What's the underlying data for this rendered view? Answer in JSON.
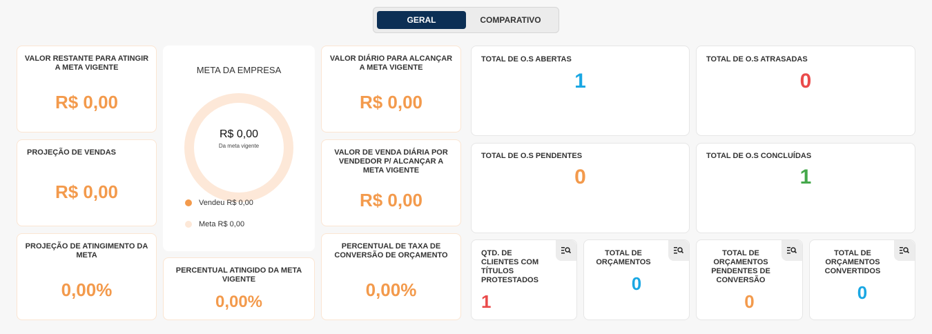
{
  "tabs": [
    {
      "label": "GERAL",
      "active": true
    },
    {
      "label": "COMPARATIVO",
      "active": false
    }
  ],
  "left_cards": {
    "valor_restante": {
      "title": "VALOR RESTANTE PARA ATINGIR A META VIGENTE",
      "value": "R$ 0,00"
    },
    "projecao_vendas": {
      "title": "PROJEÇÃO DE VENDAS",
      "value": "R$ 0,00"
    },
    "projecao_atingimento": {
      "title": "PROJEÇÃO DE ATINGIMENTO DA META",
      "value": "0,00%"
    }
  },
  "meta_empresa": {
    "title": "META DA EMPRESA",
    "center_value": "R$ 0,00",
    "center_caption": "Da meta vigente",
    "progress": 0,
    "legend": [
      {
        "label": "Vendeu",
        "value": "R$ 0,00",
        "color": "#f39a4c"
      },
      {
        "label": "Meta",
        "value": "R$ 0,00",
        "color": "#fde8d8"
      }
    ]
  },
  "percentual_atingido": {
    "title": "PERCENTUAL ATINGIDO DA META VIGENTE",
    "value": "0,00%"
  },
  "middle_cards": {
    "valor_diario": {
      "title": "VALOR DIÁRIO PARA ALCANÇAR A META VIGENTE",
      "value": "R$ 0,00"
    },
    "valor_vendedor": {
      "title": "VALOR DE VENDA DIÁRIA POR VENDEDOR P/ ALCANÇAR A META VIGENTE",
      "value": "R$ 0,00"
    },
    "percentual_conversao": {
      "title": "PERCENTUAL DE TAXA DE CONVERSÃO DE ORÇAMENTO",
      "value": "0,00%"
    }
  },
  "os_cards": {
    "abertas": {
      "title": "TOTAL DE O.S ABERTAS",
      "value": "1"
    },
    "atrasadas": {
      "title": "TOTAL DE O.S ATRASADAS",
      "value": "0"
    },
    "pendentes": {
      "title": "TOTAL DE O.S PENDENTES",
      "value": "0"
    },
    "concluidas": {
      "title": "TOTAL DE O.S CONCLUÍDAS",
      "value": "1"
    }
  },
  "small_cards": {
    "protestados": {
      "title": "QTD. DE CLIENTES COM TÍTULOS PROTESTADOS",
      "value": "1"
    },
    "orcamentos": {
      "title": "TOTAL DE ORÇAMENTOS",
      "value": "0"
    },
    "pendentes_conversao": {
      "title": "TOTAL DE ORÇAMENTOS PENDENTES DE CONVERSÃO",
      "value": "0"
    },
    "convertidos": {
      "title": "TOTAL DE ORÇAMENTOS CONVERTIDOS",
      "value": "0"
    }
  },
  "colors": {
    "orange": "#f39a4c",
    "blue": "#1aa7e3",
    "red": "#ea4b4b",
    "green": "#45a84b",
    "navy": "#0c2f55"
  },
  "icons": {
    "detail": "list-search-icon"
  }
}
